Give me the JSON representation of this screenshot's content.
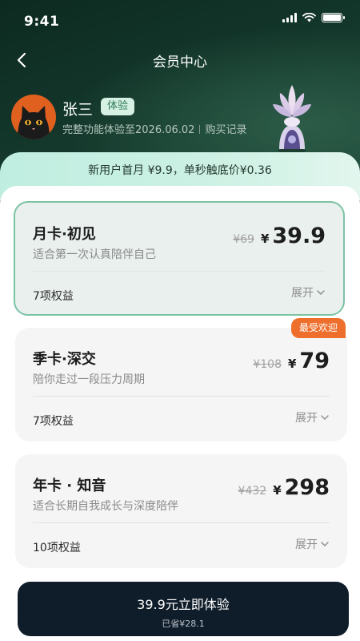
{
  "status_bar": {
    "time": "9:41"
  },
  "nav": {
    "title": "会员中心"
  },
  "profile": {
    "name": "张三",
    "badge": "体验",
    "trial_text": "完整功能体验至2026.06.02",
    "purchase_link": "购买记录"
  },
  "promo": {
    "text": "新用户首月 ¥9.9，单秒触底价¥0.36"
  },
  "plans": [
    {
      "title": "月卡·初见",
      "desc": "适合第一次认真陪伴自己",
      "original_price": "¥69",
      "currency": "¥",
      "price": "39.9",
      "benefits": "7项权益",
      "expand": "展开",
      "selected": true
    },
    {
      "title": "季卡·深交",
      "desc": "陪你走过一段压力周期",
      "original_price": "¥108",
      "currency": "¥",
      "price": "79",
      "benefits": "7项权益",
      "expand": "展开",
      "tag": "最受欢迎",
      "selected": false
    },
    {
      "title": "年卡 · 知音",
      "desc": "适合长期自我成长与深度陪伴",
      "original_price": "¥432",
      "currency": "¥",
      "price": "298",
      "benefits": "10项权益",
      "expand": "展开",
      "selected": false
    }
  ],
  "cta": {
    "label": "39.9元立即体验",
    "sub": "已省¥28.1"
  },
  "colors": {
    "accent": "#7cc3a4",
    "tag": "#ee6e2c",
    "cta_bg": "#0f1d2a",
    "header_bg": "#153a2d"
  }
}
